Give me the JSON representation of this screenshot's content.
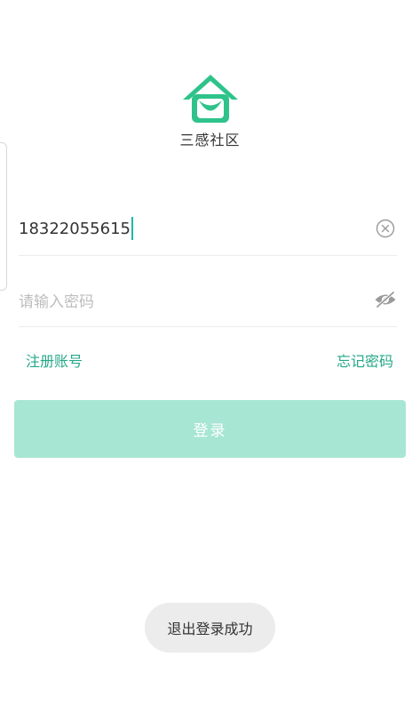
{
  "app": {
    "name": "三感社区",
    "logo_icon": "house-smile-icon",
    "brand_color": "#2ec38a"
  },
  "login_form": {
    "phone_value": "18322055615",
    "password_placeholder": "请输入密码",
    "clear_icon": "clear-circle-icon",
    "visibility_icon": "eye-off-icon"
  },
  "links": {
    "register": "注册账号",
    "forgot_password": "忘记密码"
  },
  "login_button": {
    "label": "登录",
    "color": "#a8e6d4"
  },
  "toast": {
    "message": "退出登录成功"
  }
}
